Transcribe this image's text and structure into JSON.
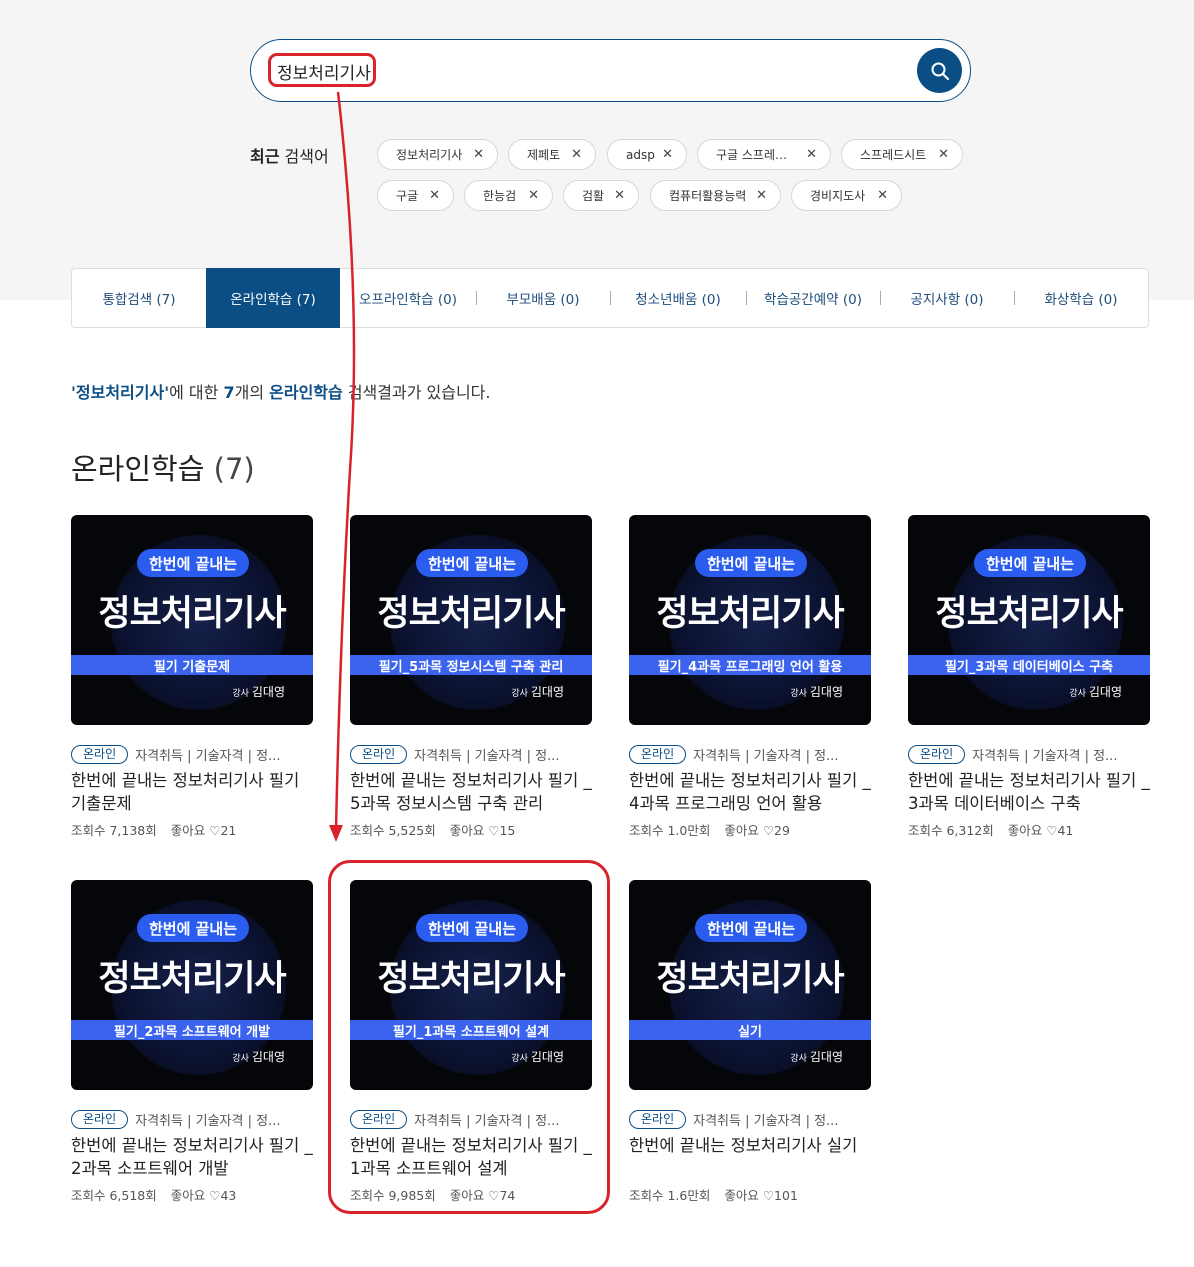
{
  "search": {
    "value": "정보처리기사",
    "placeholder": ""
  },
  "recent": {
    "label_bold": "최근",
    "label_rest": "검색어",
    "keywords": [
      "정보처리기사",
      "제페토",
      "adsp",
      "구글 스프레드시트",
      "스프레드시트",
      "구글",
      "한능검",
      "검활",
      "컴퓨터활용능력",
      "경비지도사"
    ]
  },
  "tabs": [
    {
      "label": "통합검색 (7)"
    },
    {
      "label": "온라인학습 (7)"
    },
    {
      "label": "오프라인학습 (0)"
    },
    {
      "label": "부모배움 (0)"
    },
    {
      "label": "청소년배움 (0)"
    },
    {
      "label": "학습공간예약 (0)"
    },
    {
      "label": "공지사항 (0)"
    },
    {
      "label": "화상학습 (0)"
    }
  ],
  "result_line": {
    "q": "'정보처리기사'",
    "t1": "에 대한 ",
    "count": "7",
    "t2": "개의 ",
    "section": "온라인학습",
    "t3": " 검색결과가 있습니다."
  },
  "section": {
    "title": "온라인학습",
    "count": "(7)"
  },
  "cards": [
    {
      "pill": "한번에 끝내는",
      "big": "정보처리기사",
      "bar": "필기 기출문제",
      "inst_label": "강사",
      "inst_name": "김대영",
      "badge": "온라인",
      "category": "자격취득 | 기술자격 | 정...",
      "title": "한번에 끝내는 정보처리기사 필기 기출문제",
      "views": "조회수 7,138회",
      "likes": "좋아요 ♡21"
    },
    {
      "pill": "한번에 끝내는",
      "big": "정보처리기사",
      "bar": "필기_5과목 정보시스템 구축 관리",
      "inst_label": "강사",
      "inst_name": "김대영",
      "badge": "온라인",
      "category": "자격취득 | 기술자격 | 정...",
      "title": "한번에 끝내는 정보처리기사 필기 _5과목 정보시스템 구축 관리",
      "views": "조회수 5,525회",
      "likes": "좋아요 ♡15"
    },
    {
      "pill": "한번에 끝내는",
      "big": "정보처리기사",
      "bar": "필기_4과목 프로그래밍 언어 활용",
      "inst_label": "강사",
      "inst_name": "김대영",
      "badge": "온라인",
      "category": "자격취득 | 기술자격 | 정...",
      "title": "한번에 끝내는 정보처리기사 필기 _4과목 프로그래밍 언어 활용",
      "views": "조회수 1.0만회",
      "likes": "좋아요 ♡29"
    },
    {
      "pill": "한번에 끝내는",
      "big": "정보처리기사",
      "bar": "필기_3과목 데이터베이스 구축",
      "inst_label": "강사",
      "inst_name": "김대영",
      "badge": "온라인",
      "category": "자격취득 | 기술자격 | 정...",
      "title": "한번에 끝내는 정보처리기사 필기 _3과목 데이터베이스 구축",
      "views": "조회수 6,312회",
      "likes": "좋아요 ♡41"
    },
    {
      "pill": "한번에 끝내는",
      "big": "정보처리기사",
      "bar": "필기_2과목 소프트웨어 개발",
      "inst_label": "강사",
      "inst_name": "김대영",
      "badge": "온라인",
      "category": "자격취득 | 기술자격 | 정...",
      "title": "한번에 끝내는 정보처리기사 필기 _2과목 소프트웨어 개발",
      "views": "조회수 6,518회",
      "likes": "좋아요 ♡43"
    },
    {
      "pill": "한번에 끝내는",
      "big": "정보처리기사",
      "bar": "필기_1과목 소프트웨어 설계",
      "inst_label": "강사",
      "inst_name": "김대영",
      "badge": "온라인",
      "category": "자격취득 | 기술자격 | 정...",
      "title": "한번에 끝내는 정보처리기사 필기 _1과목 소프트웨어 설계",
      "views": "조회수 9,985회",
      "likes": "좋아요 ♡74"
    },
    {
      "pill": "한번에 끝내는",
      "big": "정보처리기사",
      "bar": "실기",
      "inst_label": "강사",
      "inst_name": "김대영",
      "badge": "온라인",
      "category": "자격취득 | 기술자격 | 정...",
      "title": "한번에 끝내는 정보처리기사 실기",
      "views": "조회수 1.6만회",
      "likes": "좋아요 ♡101"
    }
  ],
  "colors": {
    "brand": "#0b4e86",
    "annotation": "#d9232b",
    "thumb_bar": "#3b63ee"
  },
  "icons": {
    "search_button": "search-icon",
    "chip_remove": "close-icon"
  }
}
